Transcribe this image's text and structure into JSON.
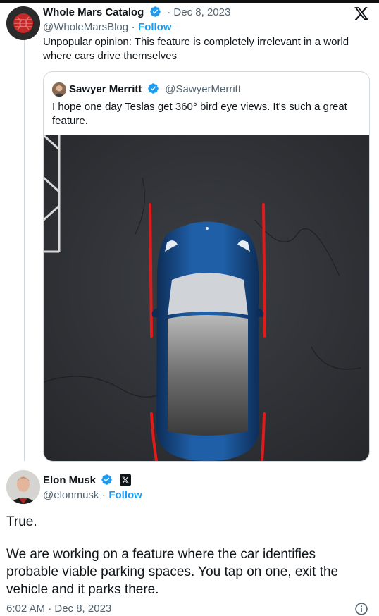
{
  "tweet1": {
    "name": "Whole Mars Catalog",
    "date": "· Dec 8, 2023",
    "handle": "@WholeMarsBlog",
    "dot": "·",
    "follow": "Follow",
    "text_line1": "Unpopular opinion: This feature is completely irrelevant in a world",
    "text_line2": "where cars drive themselves"
  },
  "quote": {
    "name": "Sawyer Merritt",
    "handle": "@SawyerMerritt",
    "text_line1": "I hope one day Teslas get 360° bird eye views. It's such a great",
    "text_line2": "feature."
  },
  "tweet2": {
    "name": "Elon Musk",
    "handle": "@elonmusk",
    "dot": "·",
    "follow": "Follow",
    "line1": "True.",
    "line2": "We are working on a feature where the car identifies",
    "line3": "probable viable parking spaces. You tap on one, exit the",
    "line4": "vehicle and it parks there.",
    "timestamp": "6:02 AM · Dec 8, 2023"
  },
  "icons": {
    "brand": "x-logo-icon",
    "verified": "verified-badge-icon",
    "info": "info-icon"
  },
  "colors": {
    "accent": "#1d9bf0",
    "text": "#0f1419",
    "muted": "#536471",
    "border": "#cfd9de"
  }
}
